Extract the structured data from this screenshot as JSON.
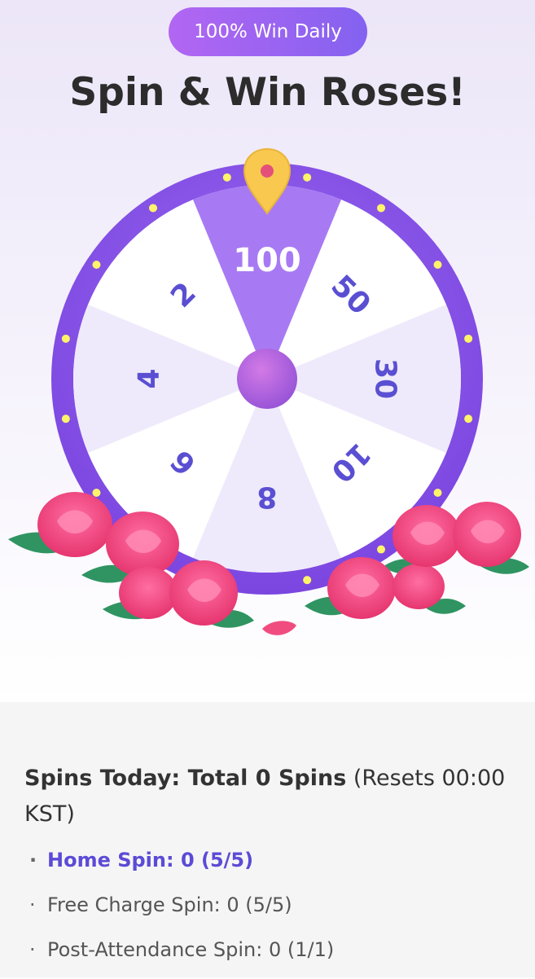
{
  "header": {
    "badge": "100% Win Daily",
    "title": "Spin & Win Roses!"
  },
  "wheel": {
    "segments": [
      "100",
      "50",
      "30",
      "10",
      "8",
      "6",
      "4",
      "2"
    ],
    "highlighted": "100",
    "colors": {
      "highlight": "#a77af4",
      "light": "#ffffff",
      "alt": "#efeafb",
      "rim": "#8b57e8",
      "text": "#5a4fd2",
      "rose": "#ee4d85",
      "leaf": "#2f9461",
      "pointer": "#f8c94e"
    }
  },
  "spins": {
    "label": "Spins Today: Total 0 Spins",
    "reset": "(Resets 00:00 KST)",
    "items": [
      {
        "bullet": "·",
        "text": "Home Spin: 0 (5/5)",
        "active": true
      },
      {
        "bullet": "·",
        "text": "Free Charge Spin: 0 (5/5)",
        "active": false
      },
      {
        "bullet": "·",
        "text": "Post-Attendance Spin: 0 (1/1)",
        "active": false
      }
    ]
  }
}
